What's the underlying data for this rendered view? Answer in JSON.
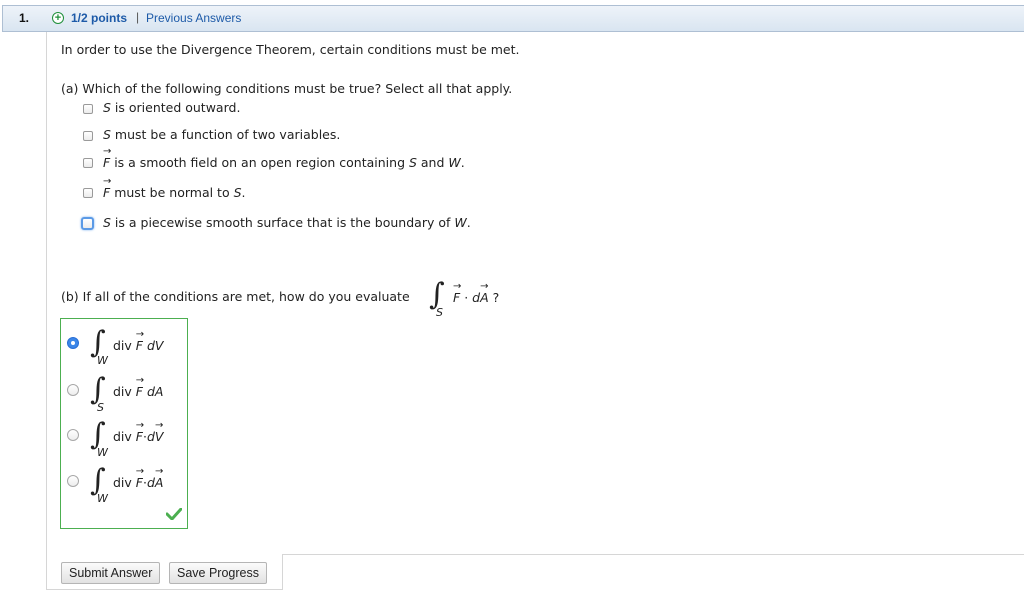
{
  "header": {
    "question_number": "1.",
    "points": "1/2 points",
    "separator": "|",
    "previous_answers": "Previous Answers"
  },
  "intro": "In order to use the Divergence Theorem, certain conditions must be met.",
  "part_a": {
    "prompt": "(a) Which of the following conditions must be true? Select all that apply.",
    "options": [
      {
        "var": "S",
        "text": " is oriented outward."
      },
      {
        "var": "S",
        "text": " must be a function of two variables."
      },
      {
        "var": "F",
        "pre": "is a smooth field on an open region containing ",
        "v1": "S",
        "mid": " and ",
        "v2": "W",
        "end": "."
      },
      {
        "var": "F",
        "pre": "must be normal to ",
        "v1": "S",
        "end": "."
      },
      {
        "var": "S",
        "pre": " is a piecewise smooth surface that is the boundary of ",
        "v1": "W",
        "end": "."
      }
    ]
  },
  "part_b": {
    "prompt": "(b) If all of the conditions are met, how do you evaluate",
    "integral_sub": "S",
    "integrand_f": "F",
    "dot": "·",
    "d": "d",
    "integrand_a": "A",
    "question_mark": "?",
    "selected_index": 0,
    "options": [
      {
        "sub": "W",
        "div": "div",
        "f": "F",
        "sep": " ",
        "d": "dV",
        "vec_d": false
      },
      {
        "sub": "S",
        "div": "div",
        "f": "F",
        "sep": " ",
        "d": "dA",
        "vec_d": false
      },
      {
        "sub": "W",
        "div": "div",
        "f": "F",
        "sep": "·",
        "d_letter": "d",
        "d_vec": "V",
        "vec_d": true
      },
      {
        "sub": "W",
        "div": "div",
        "f": "F",
        "sep": "·",
        "d_letter": "d",
        "d_vec": "A",
        "vec_d": true
      }
    ]
  },
  "buttons": {
    "submit": "Submit Answer",
    "save": "Save Progress"
  },
  "colors": {
    "header_blue_text": "#1d5aa8",
    "correct_green": "#4caf50"
  }
}
